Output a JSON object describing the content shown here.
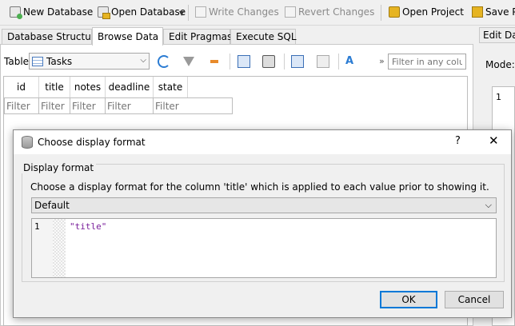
{
  "toolbar": {
    "new_database": "New Database",
    "open_database": "Open Database",
    "write_changes": "Write Changes",
    "revert_changes": "Revert Changes",
    "open_project": "Open Project",
    "save_project": "Save Pr"
  },
  "tabs": {
    "database_structure": "Database Structure",
    "browse_data": "Browse Data",
    "edit_pragmas": "Edit Pragmas",
    "execute_sql": "Execute SQL",
    "active": "Browse Data"
  },
  "right_panel": {
    "tab": "Edit Dat",
    "mode_label": "Mode:",
    "line_no": "1"
  },
  "browse": {
    "table_label": "Table:",
    "table_value": "Tasks",
    "overflow": "»",
    "filter_any_placeholder": "Filter in any column",
    "columns": [
      "id",
      "title",
      "notes",
      "deadline",
      "state"
    ],
    "filter_placeholder": "Filter"
  },
  "dialog": {
    "title": "Choose display format",
    "help": "?",
    "close": "✕",
    "group_title": "Display format",
    "description": "Choose a display format for the column 'title' which is applied to each value prior to showing it.",
    "format_value": "Default",
    "editor_line": "1",
    "editor_code": "\"title\"",
    "ok": "OK",
    "cancel": "Cancel"
  }
}
